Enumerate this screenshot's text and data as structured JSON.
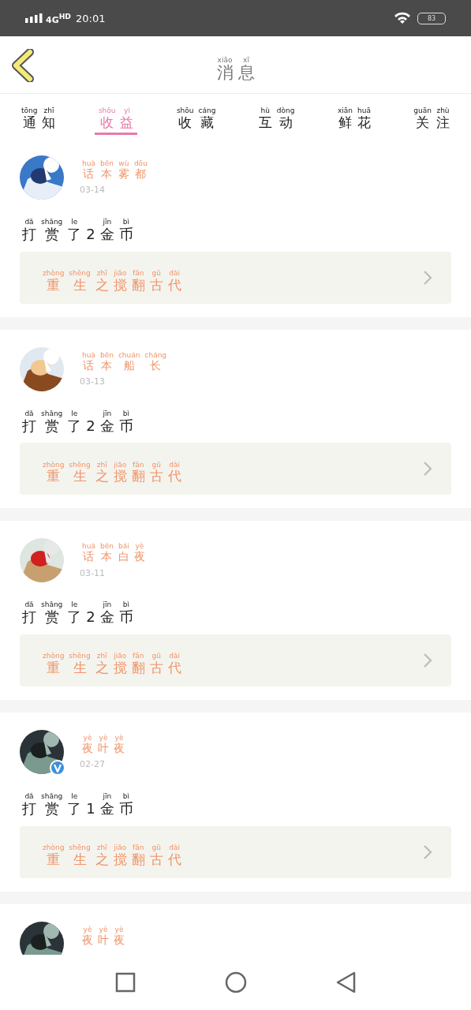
{
  "status_bar": {
    "network": "4G$^{HD}$",
    "time": "20:01",
    "battery": "83"
  },
  "header": {
    "title": [
      {
        "pinyin": "xiāo",
        "char": "消"
      },
      {
        "pinyin": "xī",
        "char": "息"
      }
    ]
  },
  "tabs": [
    {
      "label": [
        {
          "pinyin": "tōng",
          "char": "通"
        },
        {
          "pinyin": "zhī",
          "char": "知"
        }
      ],
      "selected": false
    },
    {
      "label": [
        {
          "pinyin": "shōu",
          "char": "收"
        },
        {
          "pinyin": "yì",
          "char": "益"
        }
      ],
      "selected": true
    },
    {
      "label": [
        {
          "pinyin": "shōu",
          "char": "收"
        },
        {
          "pinyin": "cáng",
          "char": "藏"
        }
      ],
      "selected": false
    },
    {
      "label": [
        {
          "pinyin": "hù",
          "char": "互"
        },
        {
          "pinyin": "dòng",
          "char": "动"
        }
      ],
      "selected": false
    },
    {
      "label": [
        {
          "pinyin": "xiān",
          "char": "鲜"
        },
        {
          "pinyin": "huā",
          "char": "花"
        }
      ],
      "selected": false
    },
    {
      "label": [
        {
          "pinyin": "guān",
          "char": "关"
        },
        {
          "pinyin": "zhù",
          "char": "注"
        }
      ],
      "selected": false
    }
  ],
  "messages": [
    {
      "avatar": {
        "kind": "picture"
      },
      "verified": false,
      "name": [
        {
          "pinyin": "huà",
          "char": "话"
        },
        {
          "pinyin": "běn",
          "char": "本"
        },
        {
          "pinyin": "wù",
          "char": "雾"
        },
        {
          "pinyin": "dōu",
          "char": "都"
        }
      ],
      "date": "03-14",
      "action": [
        {
          "pinyin": "dǎ",
          "char": "打"
        },
        {
          "pinyin": "shǎng",
          "char": "赏"
        },
        {
          "pinyin": "le",
          "char": "了"
        },
        {
          "char": "2"
        },
        {
          "pinyin": "jīn",
          "char": "金"
        },
        {
          "pinyin": "bì",
          "char": "币"
        }
      ],
      "book": [
        {
          "pinyin": "zhòng",
          "char": "重"
        },
        {
          "pinyin": "shēng",
          "char": "生"
        },
        {
          "pinyin": "zhī",
          "char": "之"
        },
        {
          "pinyin": "jiǎo",
          "char": "搅"
        },
        {
          "pinyin": "fān",
          "char": "翻"
        },
        {
          "pinyin": "gǔ",
          "char": "古"
        },
        {
          "pinyin": "dài",
          "char": "代"
        }
      ]
    },
    {
      "avatar": {
        "kind": "picture"
      },
      "verified": false,
      "name": [
        {
          "pinyin": "huà",
          "char": "话"
        },
        {
          "pinyin": "běn",
          "char": "本"
        },
        {
          "pinyin": "chuán",
          "char": "船"
        },
        {
          "pinyin": "cháng",
          "char": "长"
        }
      ],
      "date": "03-13",
      "action": [
        {
          "pinyin": "dǎ",
          "char": "打"
        },
        {
          "pinyin": "shǎng",
          "char": "赏"
        },
        {
          "pinyin": "le",
          "char": "了"
        },
        {
          "char": "2"
        },
        {
          "pinyin": "jīn",
          "char": "金"
        },
        {
          "pinyin": "bì",
          "char": "币"
        }
      ],
      "book": [
        {
          "pinyin": "zhòng",
          "char": "重"
        },
        {
          "pinyin": "shēng",
          "char": "生"
        },
        {
          "pinyin": "zhī",
          "char": "之"
        },
        {
          "pinyin": "jiǎo",
          "char": "搅"
        },
        {
          "pinyin": "fān",
          "char": "翻"
        },
        {
          "pinyin": "gǔ",
          "char": "古"
        },
        {
          "pinyin": "dài",
          "char": "代"
        }
      ]
    },
    {
      "avatar": {
        "kind": "picture"
      },
      "verified": false,
      "name": [
        {
          "pinyin": "huà",
          "char": "话"
        },
        {
          "pinyin": "běn",
          "char": "本"
        },
        {
          "pinyin": "bái",
          "char": "白"
        },
        {
          "pinyin": "yè",
          "char": "夜"
        }
      ],
      "date": "03-11",
      "action": [
        {
          "pinyin": "dǎ",
          "char": "打"
        },
        {
          "pinyin": "shǎng",
          "char": "赏"
        },
        {
          "pinyin": "le",
          "char": "了"
        },
        {
          "char": "2"
        },
        {
          "pinyin": "jīn",
          "char": "金"
        },
        {
          "pinyin": "bì",
          "char": "币"
        }
      ],
      "book": [
        {
          "pinyin": "zhòng",
          "char": "重"
        },
        {
          "pinyin": "shēng",
          "char": "生"
        },
        {
          "pinyin": "zhī",
          "char": "之"
        },
        {
          "pinyin": "jiǎo",
          "char": "搅"
        },
        {
          "pinyin": "fān",
          "char": "翻"
        },
        {
          "pinyin": "gǔ",
          "char": "古"
        },
        {
          "pinyin": "dài",
          "char": "代"
        }
      ]
    },
    {
      "avatar": {
        "kind": "picture"
      },
      "verified": true,
      "name": [
        {
          "pinyin": "yè",
          "char": "夜"
        },
        {
          "pinyin": "yè",
          "char": "叶"
        },
        {
          "pinyin": "yè",
          "char": "夜"
        }
      ],
      "date": "02-27",
      "action": [
        {
          "pinyin": "dǎ",
          "char": "打"
        },
        {
          "pinyin": "shǎng",
          "char": "赏"
        },
        {
          "pinyin": "le",
          "char": "了"
        },
        {
          "char": "1"
        },
        {
          "pinyin": "jīn",
          "char": "金"
        },
        {
          "pinyin": "bì",
          "char": "币"
        }
      ],
      "book": [
        {
          "pinyin": "zhòng",
          "char": "重"
        },
        {
          "pinyin": "shēng",
          "char": "生"
        },
        {
          "pinyin": "zhī",
          "char": "之"
        },
        {
          "pinyin": "jiǎo",
          "char": "搅"
        },
        {
          "pinyin": "fān",
          "char": "翻"
        },
        {
          "pinyin": "gǔ",
          "char": "古"
        },
        {
          "pinyin": "dài",
          "char": "代"
        }
      ]
    },
    {
      "avatar": {
        "kind": "picture"
      },
      "name": [
        {
          "pinyin": "yè",
          "char": "夜"
        },
        {
          "pinyin": "yè",
          "char": "叶"
        },
        {
          "pinyin": "yè",
          "char": "夜"
        }
      ]
    }
  ]
}
